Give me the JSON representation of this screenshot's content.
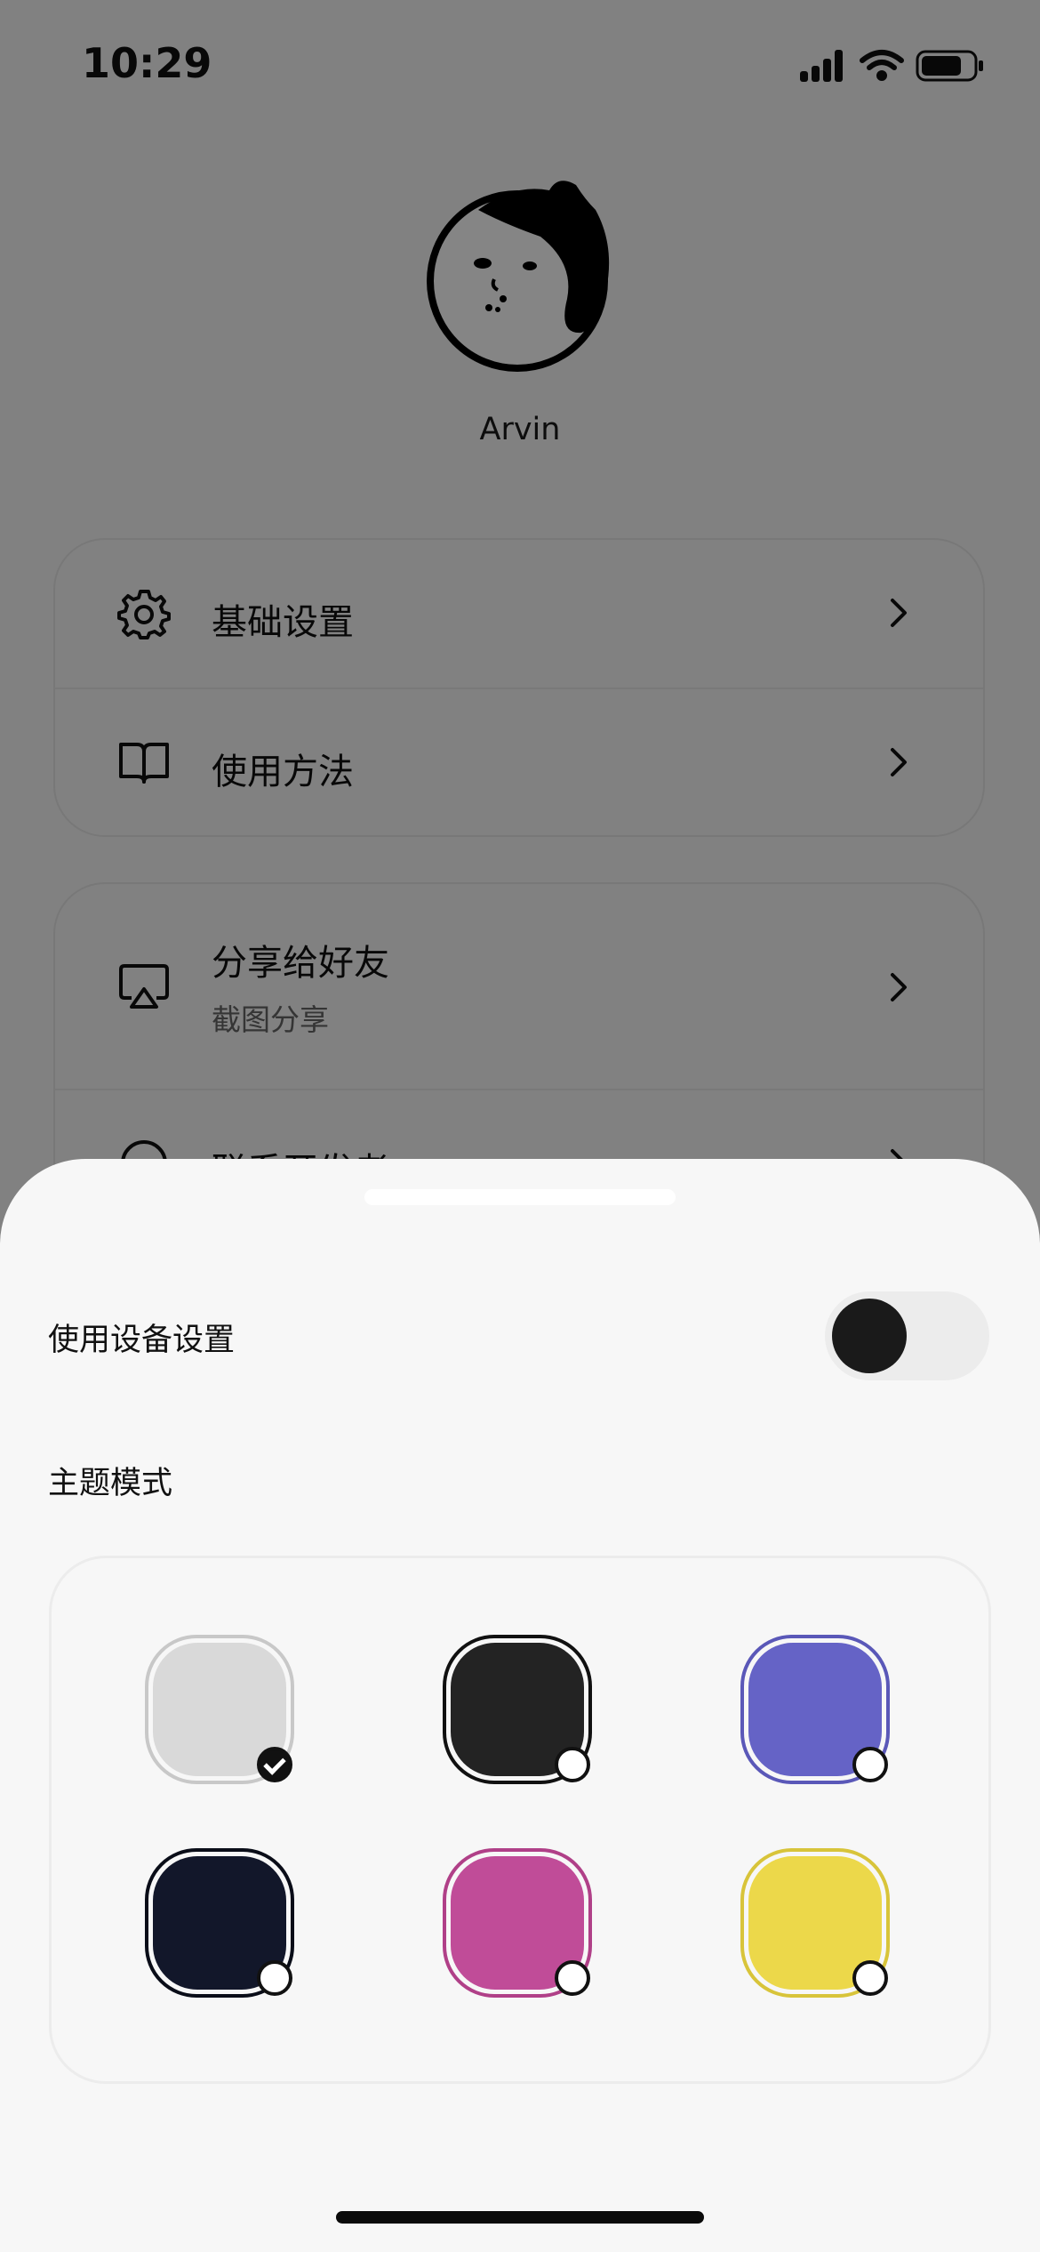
{
  "status_bar": {
    "time": "10:29"
  },
  "profile": {
    "username": "Arvin"
  },
  "menu": {
    "group1": [
      {
        "label": "基础设置",
        "icon": "gear-icon"
      },
      {
        "label": "使用方法",
        "icon": "book-icon"
      }
    ],
    "group2": [
      {
        "label": "分享给好友",
        "sublabel": "截图分享",
        "icon": "airplay-share-icon"
      },
      {
        "label": "联系开发者",
        "icon": "chat-icon"
      }
    ]
  },
  "sheet": {
    "device_settings_label": "使用设备设置",
    "device_settings_enabled": false,
    "theme_mode_label": "主题模式",
    "themes": [
      {
        "name": "light-gray",
        "color": "#d9d9d9",
        "border": "#c8c8c8",
        "selected": true
      },
      {
        "name": "dark",
        "color": "#232323",
        "border": "#111111",
        "selected": false
      },
      {
        "name": "indigo",
        "color": "#6563c6",
        "border": "#5a58b8",
        "selected": false
      },
      {
        "name": "navy",
        "color": "#12172a",
        "border": "#0a0d18",
        "selected": false
      },
      {
        "name": "magenta",
        "color": "#c04c98",
        "border": "#b04088",
        "selected": false
      },
      {
        "name": "yellow",
        "color": "#ecd84a",
        "border": "#d8c43a",
        "selected": false
      }
    ]
  }
}
